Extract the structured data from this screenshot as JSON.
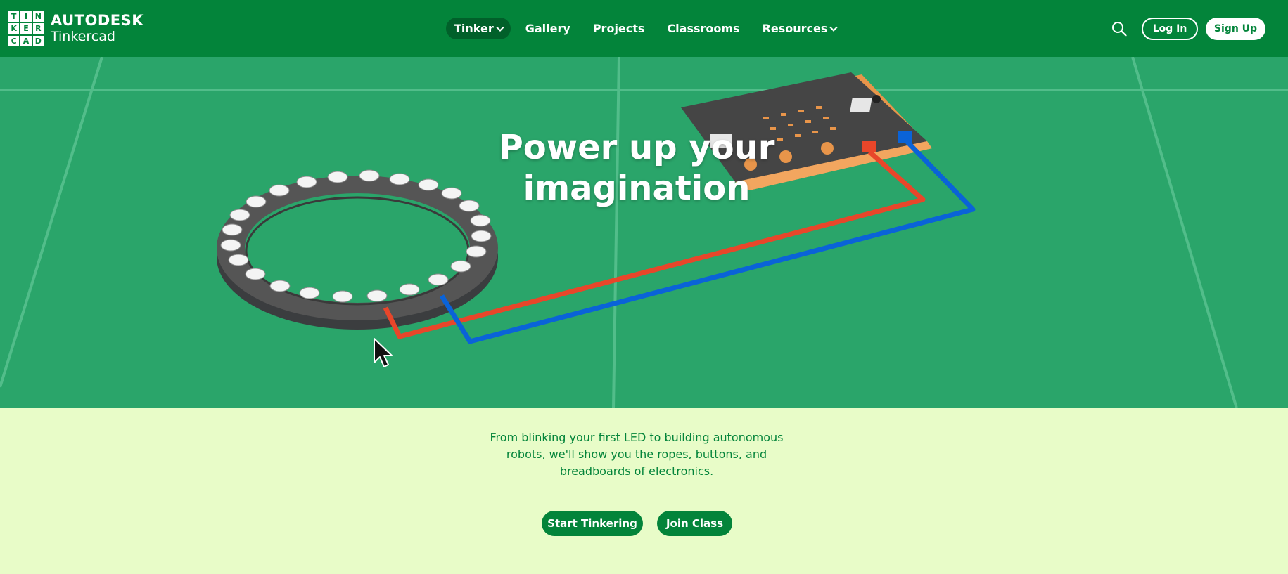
{
  "brand": {
    "logo_letters": [
      "T",
      "I",
      "N",
      "K",
      "E",
      "R",
      "C",
      "A",
      "D"
    ],
    "company": "AUTODESK",
    "product": "Tinkercad"
  },
  "nav": {
    "items": [
      {
        "label": "Tinker",
        "dropdown": true,
        "active": true
      },
      {
        "label": "Gallery",
        "dropdown": false,
        "active": false
      },
      {
        "label": "Projects",
        "dropdown": false,
        "active": false
      },
      {
        "label": "Classrooms",
        "dropdown": false,
        "active": false
      },
      {
        "label": "Resources",
        "dropdown": true,
        "active": false
      }
    ],
    "search_icon": "search-icon",
    "login_label": "Log In",
    "signup_label": "Sign Up"
  },
  "hero": {
    "title_line1": "Power up your",
    "title_line2": "imagination"
  },
  "intro": {
    "text_line1": "From blinking your first LED to building autonomous",
    "text_line2": "robots, we'll show you the ropes, buttons, and",
    "text_line3": "breadboards of electronics."
  },
  "actions": {
    "start_label": "Start Tinkering",
    "join_label": "Join Class"
  },
  "colors": {
    "header_green": "#03843a",
    "hero_green": "#2aa56a",
    "lower_bg": "#e8fcc8",
    "wire_red": "#e8462a",
    "wire_blue": "#0a63d8"
  }
}
